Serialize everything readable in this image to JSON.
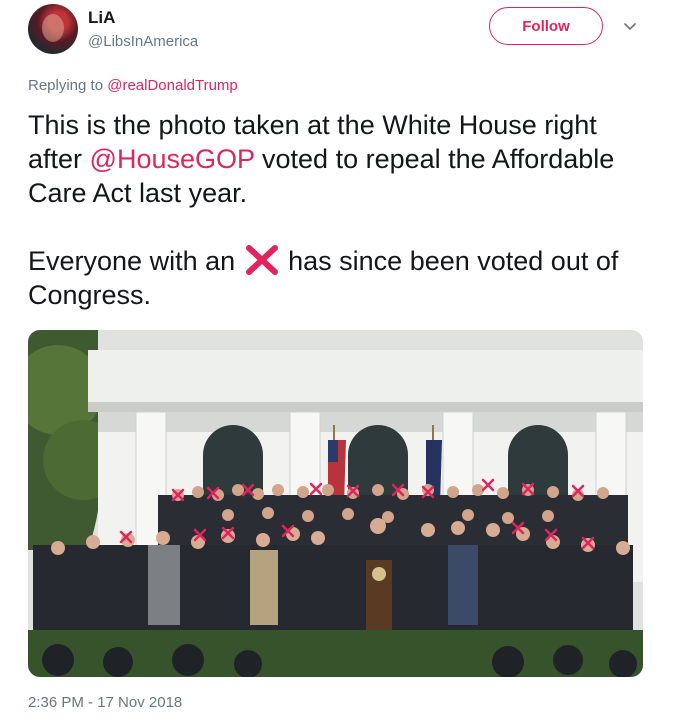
{
  "author": {
    "name": "LiA",
    "handle": "@LibsInAmerica"
  },
  "follow_label": "Follow",
  "reply_to": {
    "prefix": "Replying to ",
    "mention": "@realDonaldTrump"
  },
  "tweet": {
    "line1_pre": "This is the photo taken at the White House right after ",
    "line1_mention": "@HouseGOP",
    "line1_post": " voted to repeal the Affordable Care Act last year.",
    "line2_pre": "Everyone with an ",
    "line2_post": " has since been voted out of Congress."
  },
  "timestamp": "2:36 PM - 17 Nov 2018",
  "icons": {
    "chevron": "chevron-down-icon",
    "cross": "cross-mark-emoji"
  },
  "colors": {
    "accent": "#e0245e",
    "muted": "#657786",
    "text": "#14171a",
    "cross_red": "#e0245e"
  }
}
